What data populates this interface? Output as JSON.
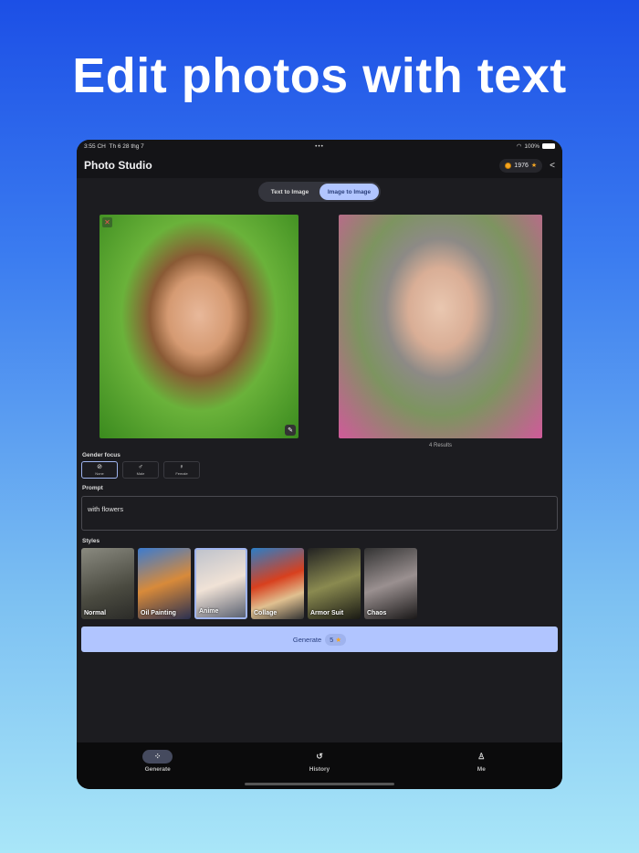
{
  "headline": "Edit photos with text",
  "status": {
    "time": "3:55 CH",
    "date": "Th 6 28 thg 7",
    "dots": "•••",
    "battery": "100%"
  },
  "header": {
    "title": "Photo Studio",
    "coins": "1976",
    "star": "★",
    "share": "<"
  },
  "tabs": [
    {
      "label": "Text to Image"
    },
    {
      "label": "Image to Image"
    }
  ],
  "results_label": "4 Results",
  "gender": {
    "label": "Gender focus",
    "options": [
      {
        "label": "None",
        "icon": "⊘"
      },
      {
        "label": "Male",
        "icon": "♂"
      },
      {
        "label": "Female",
        "icon": "♀"
      }
    ]
  },
  "prompt": {
    "label": "Prompt",
    "value": "with flowers"
  },
  "styles": {
    "label": "Styles",
    "items": [
      {
        "label": "Normal"
      },
      {
        "label": "Oil Painting"
      },
      {
        "label": "Anime"
      },
      {
        "label": "Collage"
      },
      {
        "label": "Armor Suit"
      },
      {
        "label": "Chaos"
      }
    ]
  },
  "generate": {
    "label": "Generate",
    "cost": "5",
    "star": "★"
  },
  "nav": [
    {
      "label": "Generate",
      "icon": "⁘"
    },
    {
      "label": "History",
      "icon": "↺"
    },
    {
      "label": "Me",
      "icon": "♙"
    }
  ]
}
